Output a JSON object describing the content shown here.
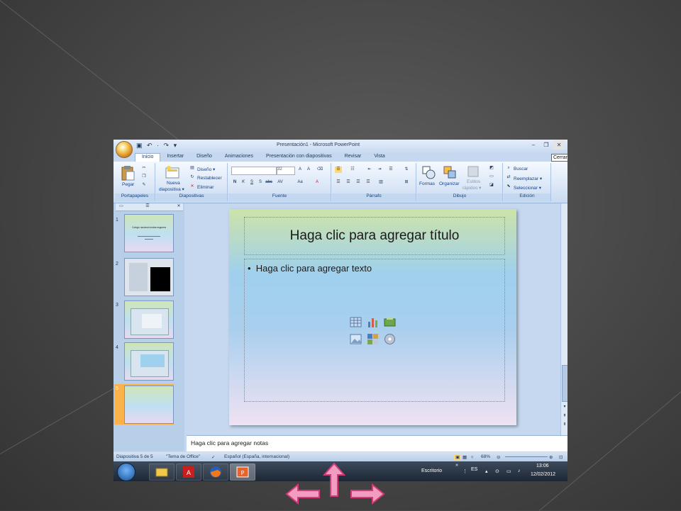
{
  "window": {
    "title": "Presentación1 - Microsoft PowerPoint",
    "qat": "▣ ↶ · ↷ ▾",
    "controls": [
      "–",
      "❐",
      "✕"
    ],
    "tooltip": "Cerrar"
  },
  "tabs": [
    "Inicio",
    "Insertar",
    "Diseño",
    "Animaciones",
    "Presentación con diapositivas",
    "Revisar",
    "Vista"
  ],
  "ribbon": {
    "groups": {
      "portapapeles": "Portapapeles",
      "diapositivas": "Diapositivas",
      "fuente": "Fuente",
      "parrafo": "Párrafo",
      "dibujo": "Dibujo",
      "edicion": "Edición"
    },
    "pegar": "Pegar",
    "nueva_1": "Nueva",
    "nueva_2": "diapositiva ▾",
    "diseno": "Diseño ▾",
    "restablecer": "Restablecer",
    "eliminar": "Eliminar",
    "font_size": "32",
    "formas": "Formas",
    "organizar": "Organizar",
    "estilos_1": "Estilos",
    "estilos_2": "rápidos ▾",
    "buscar": "Buscar",
    "reemplazar": "Reemplazar ▾",
    "seleccionar": "Seleccionar ▾"
  },
  "thumbnails": [
    {
      "num": "1",
      "title": "Colegio nacional nicolas esguerra"
    },
    {
      "num": "2"
    },
    {
      "num": "3"
    },
    {
      "num": "4"
    },
    {
      "num": "5"
    }
  ],
  "slide": {
    "title": "Haga clic para agregar título",
    "body": "Haga clic para agregar texto"
  },
  "notes": "Haga clic para agregar notas",
  "status": {
    "slide": "Diapositiva 5 de 5",
    "theme": "\"Tema de Office\"",
    "lang": "Español (España, internacional)",
    "zoom": "68%"
  },
  "taskbar": {
    "desktop": "Escritorio",
    "lang": "ES",
    "time": "13:06",
    "date": "12/02/2012"
  },
  "colors": {
    "arrow_pink": "#e94f8c"
  }
}
